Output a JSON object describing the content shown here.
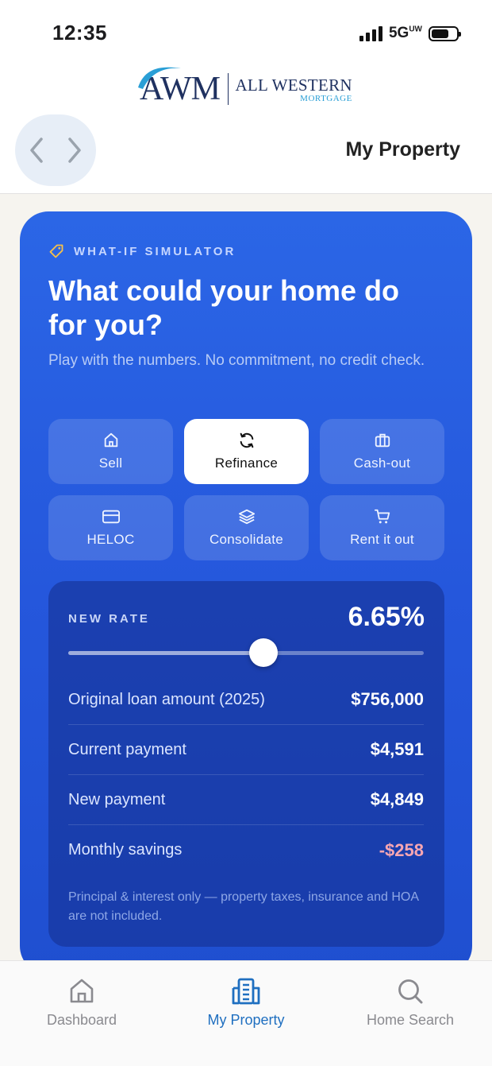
{
  "status_bar": {
    "time": "12:35",
    "network": "5G",
    "network_suffix": "UW"
  },
  "header": {
    "logo_mark": "AWM",
    "logo_line1": "ALL WESTERN",
    "logo_line2": "MORTGAGE",
    "title": "My Property"
  },
  "simulator": {
    "eyebrow": "WHAT-IF SIMULATOR",
    "title": "What could your home do for you?",
    "subtitle": "Play with the numbers. No commitment, no credit check.",
    "options": [
      {
        "label": "Sell",
        "icon": "home-icon",
        "active": false
      },
      {
        "label": "Refinance",
        "icon": "refresh-icon",
        "active": true
      },
      {
        "label": "Cash-out",
        "icon": "briefcase-icon",
        "active": false
      },
      {
        "label": "HELOC",
        "icon": "credit-card-icon",
        "active": false
      },
      {
        "label": "Consolidate",
        "icon": "layers-icon",
        "active": false
      },
      {
        "label": "Rent it out",
        "icon": "cart-icon",
        "active": false
      }
    ],
    "rate_label": "NEW RATE",
    "rate_value": "6.65%",
    "rate_slider_fraction": 0.55,
    "rows": [
      {
        "label": "Original loan amount (2025)",
        "value": "$756,000"
      },
      {
        "label": "Current payment",
        "value": "$4,591"
      },
      {
        "label": "New payment",
        "value": "$4,849"
      },
      {
        "label": "Monthly savings",
        "value": "-$258"
      }
    ],
    "disclaimer": "Principal & interest only — property taxes, insurance and HOA are not included."
  },
  "tabbar": {
    "tabs": [
      {
        "label": "Dashboard",
        "icon": "home-icon",
        "active": false
      },
      {
        "label": "My Property",
        "icon": "building-icon",
        "active": true
      },
      {
        "label": "Home Search",
        "icon": "search-icon",
        "active": false
      }
    ]
  },
  "colors": {
    "card_blue": "#2557dc",
    "accent_tab": "#1f6fc0",
    "negative": "#f7a6b2",
    "logo_navy": "#1f3160",
    "logo_cyan": "#2a9fd6"
  }
}
